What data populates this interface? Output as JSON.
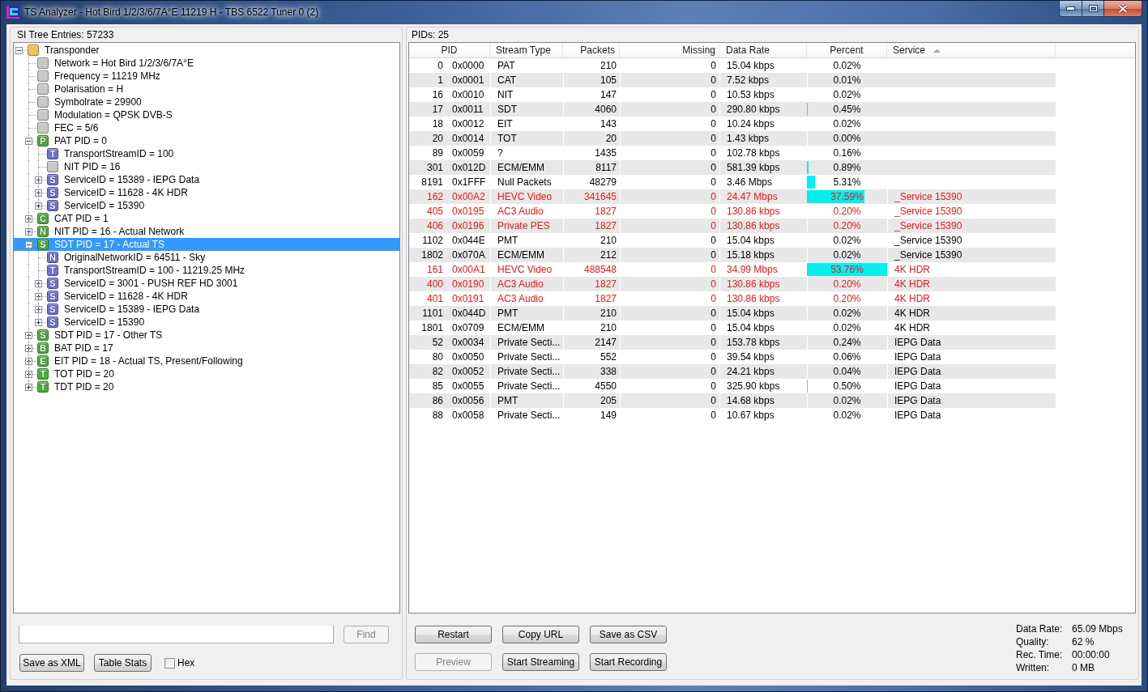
{
  "window": {
    "title": "TS Analyzer - Hot Bird 1/2/3/6/7A°E 11219 H - TBS 6522 Tuner 0 (2)"
  },
  "si_tree": {
    "heading": "SI Tree Entries: 57233",
    "nodes": [
      {
        "label": "Transponder",
        "color": "#f0c45a",
        "expanded": true,
        "selected": false,
        "children": [
          {
            "label": "Network = Hot Bird 1/2/3/6/7A°E",
            "color": "#c8c8c8",
            "selected": false
          },
          {
            "label": "Frequency = 11219 MHz",
            "color": "#c8c8c8",
            "selected": false
          },
          {
            "label": "Polarisation = H",
            "color": "#c8c8c8",
            "selected": false
          },
          {
            "label": "Symbolrate = 29900",
            "color": "#c8c8c8",
            "selected": false
          },
          {
            "label": "Modulation = QPSK DVB-S",
            "color": "#c8c8c8",
            "selected": false
          },
          {
            "label": "FEC = 5/6",
            "color": "#c8c8c8",
            "selected": false
          },
          {
            "label": "PAT PID = 0",
            "letter": "P",
            "color": "#4caf3a",
            "expanded": true,
            "selected": false,
            "children": [
              {
                "label": "TransportStreamID = 100",
                "letter": "T",
                "color": "#6d72d9",
                "selected": false
              },
              {
                "label": "NIT PID = 16",
                "color": "#c8c8c8",
                "selected": false
              },
              {
                "label": "ServiceID = 15389 - IEPG Data",
                "letter": "S",
                "color": "#6d72d9",
                "expanded": false,
                "selected": false
              },
              {
                "label": "ServiceID = 11628 - 4K HDR",
                "letter": "S",
                "color": "#6d72d9",
                "expanded": false,
                "selected": false
              },
              {
                "label": "ServiceID = 15390",
                "letter": "S",
                "color": "#6d72d9",
                "expanded": false,
                "selected": false
              }
            ]
          },
          {
            "label": "CAT PID = 1",
            "letter": "C",
            "color": "#4caf3a",
            "expanded": false,
            "selected": false
          },
          {
            "label": "NIT PID = 16 - Actual Network",
            "letter": "N",
            "color": "#4caf3a",
            "expanded": false,
            "selected": false
          },
          {
            "label": "SDT PID = 17 - Actual TS",
            "letter": "S",
            "color": "#4caf3a",
            "expanded": true,
            "selected": true,
            "children": [
              {
                "label": "OriginalNetworkID = 64511 - Sky",
                "letter": "N",
                "color": "#6d72d9",
                "selected": false
              },
              {
                "label": "TransportStreamID = 100 - 11219.25 MHz",
                "letter": "T",
                "color": "#6d72d9",
                "selected": false
              },
              {
                "label": "ServiceID = 3001 - PUSH REF HD 3001",
                "letter": "S",
                "color": "#6d72d9",
                "expanded": false,
                "selected": false
              },
              {
                "label": "ServiceID = 11628 - 4K HDR",
                "letter": "S",
                "color": "#6d72d9",
                "expanded": false,
                "selected": false
              },
              {
                "label": "ServiceID = 15389 - IEPG Data",
                "letter": "S",
                "color": "#6d72d9",
                "expanded": false,
                "selected": false
              },
              {
                "label": "ServiceID = 15390",
                "letter": "S",
                "color": "#6d72d9",
                "expanded": false,
                "selected": false
              }
            ]
          },
          {
            "label": "SDT PID = 17 - Other TS",
            "letter": "S",
            "color": "#4caf3a",
            "expanded": false,
            "selected": false
          },
          {
            "label": "BAT PID = 17",
            "letter": "B",
            "color": "#4caf3a",
            "expanded": false,
            "selected": false
          },
          {
            "label": "EIT PID = 18 - Actual TS, Present/Following",
            "letter": "E",
            "color": "#4caf3a",
            "expanded": false,
            "selected": false
          },
          {
            "label": "TOT PID = 20",
            "letter": "T",
            "color": "#4caf3a",
            "expanded": false,
            "selected": false
          },
          {
            "label": "TDT PID = 20",
            "letter": "T",
            "color": "#4caf3a",
            "expanded": false,
            "selected": false
          }
        ]
      }
    ]
  },
  "tree_tools": {
    "find_button": {
      "label": "Find",
      "disabled": true
    },
    "buttons": [
      {
        "label": "Save as XML",
        "disabled": false
      },
      {
        "label": "Table Stats",
        "disabled": false
      }
    ],
    "hex": {
      "label": "Hex",
      "checked": false
    }
  },
  "pid_table": {
    "heading": "PIDs: 25",
    "columns": [
      {
        "label": "PID",
        "sorted": false
      },
      {
        "label": "Stream Type",
        "sorted": false
      },
      {
        "label": "Packets",
        "sorted": false
      },
      {
        "label": "Missing",
        "sorted": false
      },
      {
        "label": "Data Rate",
        "sorted": false
      },
      {
        "label": "Percent",
        "sorted": false
      },
      {
        "label": "Service",
        "sorted": true
      }
    ],
    "rows": [
      {
        "pid": "0",
        "hex": "0x0000",
        "stream_type": "PAT",
        "packets": "210",
        "missing": "0",
        "data_rate": "15.04 kbps",
        "percent": "0.02%",
        "color": "#000000"
      },
      {
        "pid": "1",
        "hex": "0x0001",
        "stream_type": "CAT",
        "packets": "105",
        "missing": "0",
        "data_rate": "7.52 kbps",
        "percent": "0.01%",
        "color": "#000000"
      },
      {
        "pid": "16",
        "hex": "0x0010",
        "stream_type": "NIT",
        "packets": "147",
        "missing": "0",
        "data_rate": "10.53 kbps",
        "percent": "0.02%",
        "color": "#000000"
      },
      {
        "pid": "17",
        "hex": "0x0011",
        "stream_type": "SDT",
        "packets": "4060",
        "missing": "0",
        "data_rate": "290.80 kbps",
        "percent": "0.45%",
        "level": 0.01,
        "color": "#000000"
      },
      {
        "pid": "18",
        "hex": "0x0012",
        "stream_type": "EIT",
        "packets": "143",
        "missing": "0",
        "data_rate": "10.24 kbps",
        "percent": "0.02%",
        "color": "#000000"
      },
      {
        "pid": "20",
        "hex": "0x0014",
        "stream_type": "TOT",
        "packets": "20",
        "missing": "0",
        "data_rate": "1.43 kbps",
        "percent": "0.00%",
        "color": "#000000"
      },
      {
        "pid": "89",
        "hex": "0x0059",
        "stream_type": "?",
        "packets": "1435",
        "missing": "0",
        "data_rate": "102.78 kbps",
        "percent": "0.16%",
        "color": "#000000"
      },
      {
        "pid": "301",
        "hex": "0x012D",
        "stream_type": "ECM/EMM",
        "packets": "8117",
        "missing": "0",
        "data_rate": "581.39 kbps",
        "percent": "0.89%",
        "level": 0.02,
        "color": "#000000"
      },
      {
        "pid": "8191",
        "hex": "0x1FFF",
        "stream_type": "Null Packets",
        "packets": "48279",
        "missing": "0",
        "data_rate": "3.46 Mbps",
        "percent": "5.31%",
        "level": 0.1,
        "color": "#000000"
      },
      {
        "pid": "162",
        "hex": "0x00A2",
        "stream_type": "HEVC Video",
        "packets": "341645",
        "missing": "0",
        "data_rate": "24.47 Mbps",
        "percent": "37.59%",
        "level": 0.72,
        "service": "_Service 15390",
        "color": "#e01b1b"
      },
      {
        "pid": "405",
        "hex": "0x0195",
        "stream_type": "AC3 Audio",
        "packets": "1827",
        "missing": "0",
        "data_rate": "130.86 kbps",
        "percent": "0.20%",
        "service": "_Service 15390",
        "color": "#e01b1b"
      },
      {
        "pid": "406",
        "hex": "0x0196",
        "stream_type": "Private PES",
        "packets": "1827",
        "missing": "0",
        "data_rate": "130.86 kbps",
        "percent": "0.20%",
        "service": "_Service 15390",
        "color": "#e01b1b"
      },
      {
        "pid": "1102",
        "hex": "0x044E",
        "stream_type": "PMT",
        "packets": "210",
        "missing": "0",
        "data_rate": "15.04 kbps",
        "percent": "0.02%",
        "service": "_Service 15390",
        "color": "#000000"
      },
      {
        "pid": "1802",
        "hex": "0x070A",
        "stream_type": "ECM/EMM",
        "packets": "212",
        "missing": "0",
        "data_rate": "15.18 kbps",
        "percent": "0.02%",
        "service": "_Service 15390",
        "color": "#000000"
      },
      {
        "pid": "161",
        "hex": "0x00A1",
        "stream_type": "HEVC Video",
        "packets": "488548",
        "missing": "0",
        "data_rate": "34.99 Mbps",
        "percent": "53.76%",
        "level": 1,
        "service": "4K HDR",
        "color": "#e01b1b"
      },
      {
        "pid": "400",
        "hex": "0x0190",
        "stream_type": "AC3 Audio",
        "packets": "1827",
        "missing": "0",
        "data_rate": "130.86 kbps",
        "percent": "0.20%",
        "service": "4K HDR",
        "color": "#e01b1b"
      },
      {
        "pid": "401",
        "hex": "0x0191",
        "stream_type": "AC3 Audio",
        "packets": "1827",
        "missing": "0",
        "data_rate": "130.86 kbps",
        "percent": "0.20%",
        "service": "4K HDR",
        "color": "#e01b1b"
      },
      {
        "pid": "1101",
        "hex": "0x044D",
        "stream_type": "PMT",
        "packets": "210",
        "missing": "0",
        "data_rate": "15.04 kbps",
        "percent": "0.02%",
        "service": "4K HDR",
        "color": "#000000"
      },
      {
        "pid": "1801",
        "hex": "0x0709",
        "stream_type": "ECM/EMM",
        "packets": "210",
        "missing": "0",
        "data_rate": "15.04 kbps",
        "percent": "0.02%",
        "service": "4K HDR",
        "color": "#000000"
      },
      {
        "pid": "52",
        "hex": "0x0034",
        "stream_type": "Private Secti...",
        "packets": "2147",
        "missing": "0",
        "data_rate": "153.78 kbps",
        "percent": "0.24%",
        "service": "IEPG Data",
        "color": "#000000"
      },
      {
        "pid": "80",
        "hex": "0x0050",
        "stream_type": "Private Secti...",
        "packets": "552",
        "missing": "0",
        "data_rate": "39.54 kbps",
        "percent": "0.06%",
        "service": "IEPG Data",
        "color": "#000000"
      },
      {
        "pid": "82",
        "hex": "0x0052",
        "stream_type": "Private Secti...",
        "packets": "338",
        "missing": "0",
        "data_rate": "24.21 kbps",
        "percent": "0.04%",
        "service": "IEPG Data",
        "color": "#000000"
      },
      {
        "pid": "85",
        "hex": "0x0055",
        "stream_type": "Private Secti...",
        "packets": "4550",
        "missing": "0",
        "data_rate": "325.90 kbps",
        "percent": "0.50%",
        "level": 0.01,
        "service": "IEPG Data",
        "color": "#000000"
      },
      {
        "pid": "86",
        "hex": "0x0056",
        "stream_type": "PMT",
        "packets": "205",
        "missing": "0",
        "data_rate": "14.68 kbps",
        "percent": "0.02%",
        "service": "IEPG Data",
        "color": "#000000"
      },
      {
        "pid": "88",
        "hex": "0x0058",
        "stream_type": "Private Secti...",
        "packets": "149",
        "missing": "0",
        "data_rate": "10.67 kbps",
        "percent": "0.02%",
        "service": "IEPG Data",
        "color": "#000000"
      }
    ]
  },
  "actions": [
    {
      "label": "Restart",
      "disabled": false
    },
    {
      "label": "Copy URL",
      "disabled": false
    },
    {
      "label": "Save as CSV",
      "disabled": false
    },
    {
      "label": "Preview",
      "disabled": true
    },
    {
      "label": "Start Streaming",
      "disabled": false
    },
    {
      "label": "Start Recording",
      "disabled": false
    }
  ],
  "status": [
    {
      "label": "Data Rate:",
      "value": "65.09 Mbps"
    },
    {
      "label": "Quality:",
      "value": "62 %"
    },
    {
      "label": "Rec. Time:",
      "value": "00:00:00"
    },
    {
      "label": "Written:",
      "value": "0 MB"
    }
  ]
}
